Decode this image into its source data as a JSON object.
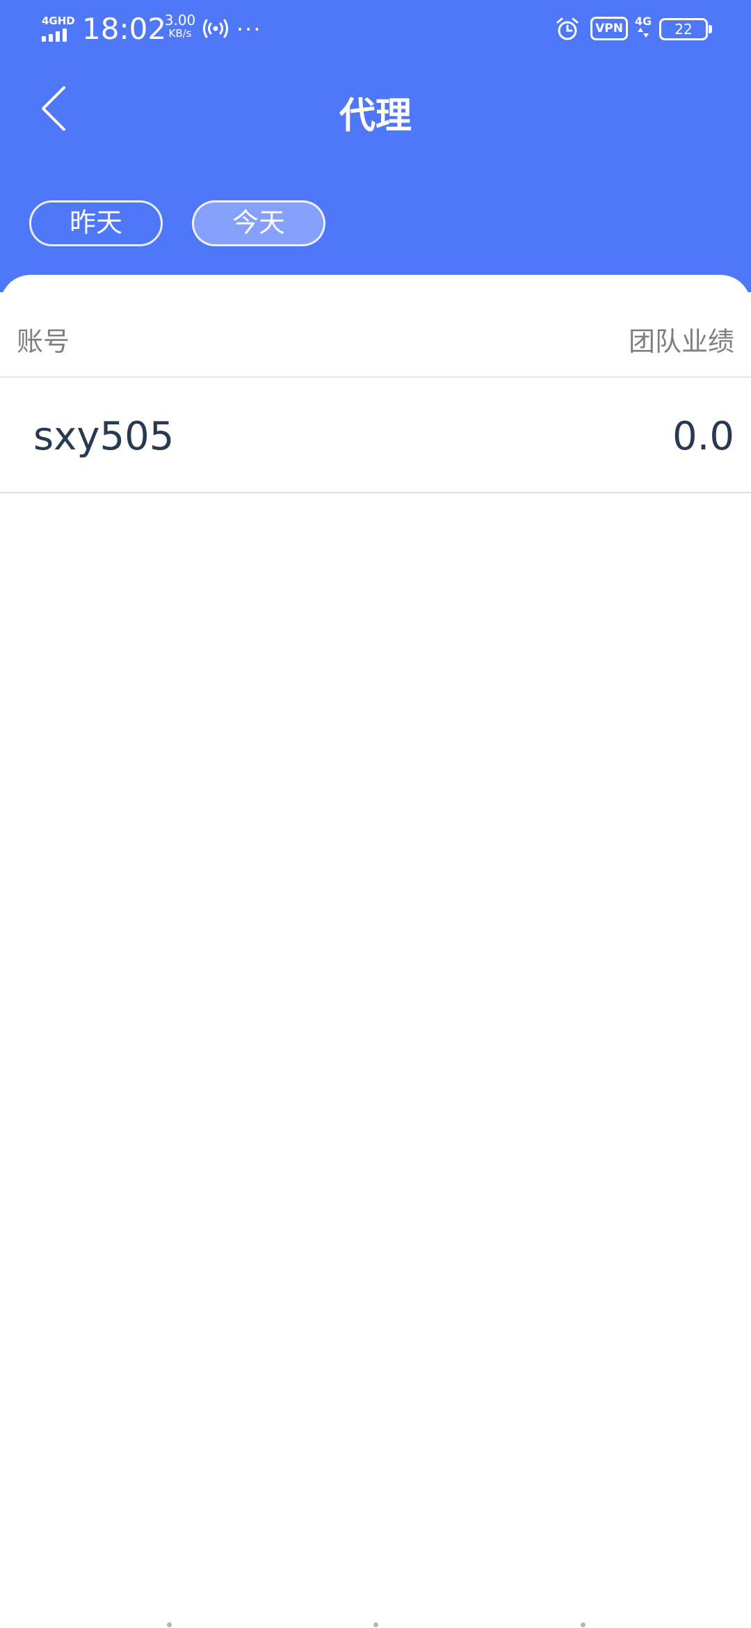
{
  "status_bar": {
    "network_tag": "4GHD",
    "time": "18:02",
    "speed_value": "3.00",
    "speed_unit": "KB/s",
    "overflow": "···",
    "vpn": "VPN",
    "network_type": "4G",
    "battery": "22"
  },
  "nav": {
    "title": "代理",
    "back_icon": "chevron-left-icon"
  },
  "tabs": [
    {
      "label": "昨天",
      "selected": false
    },
    {
      "label": "今天",
      "selected": true
    }
  ],
  "table": {
    "headers": {
      "account": "账号",
      "performance": "团队业绩"
    },
    "rows": [
      {
        "account": "sxy505",
        "performance": "0.0"
      }
    ]
  },
  "colors": {
    "header_bg": "#4f78f8",
    "text_primary": "#273a52",
    "text_secondary": "#7f7f7f"
  }
}
